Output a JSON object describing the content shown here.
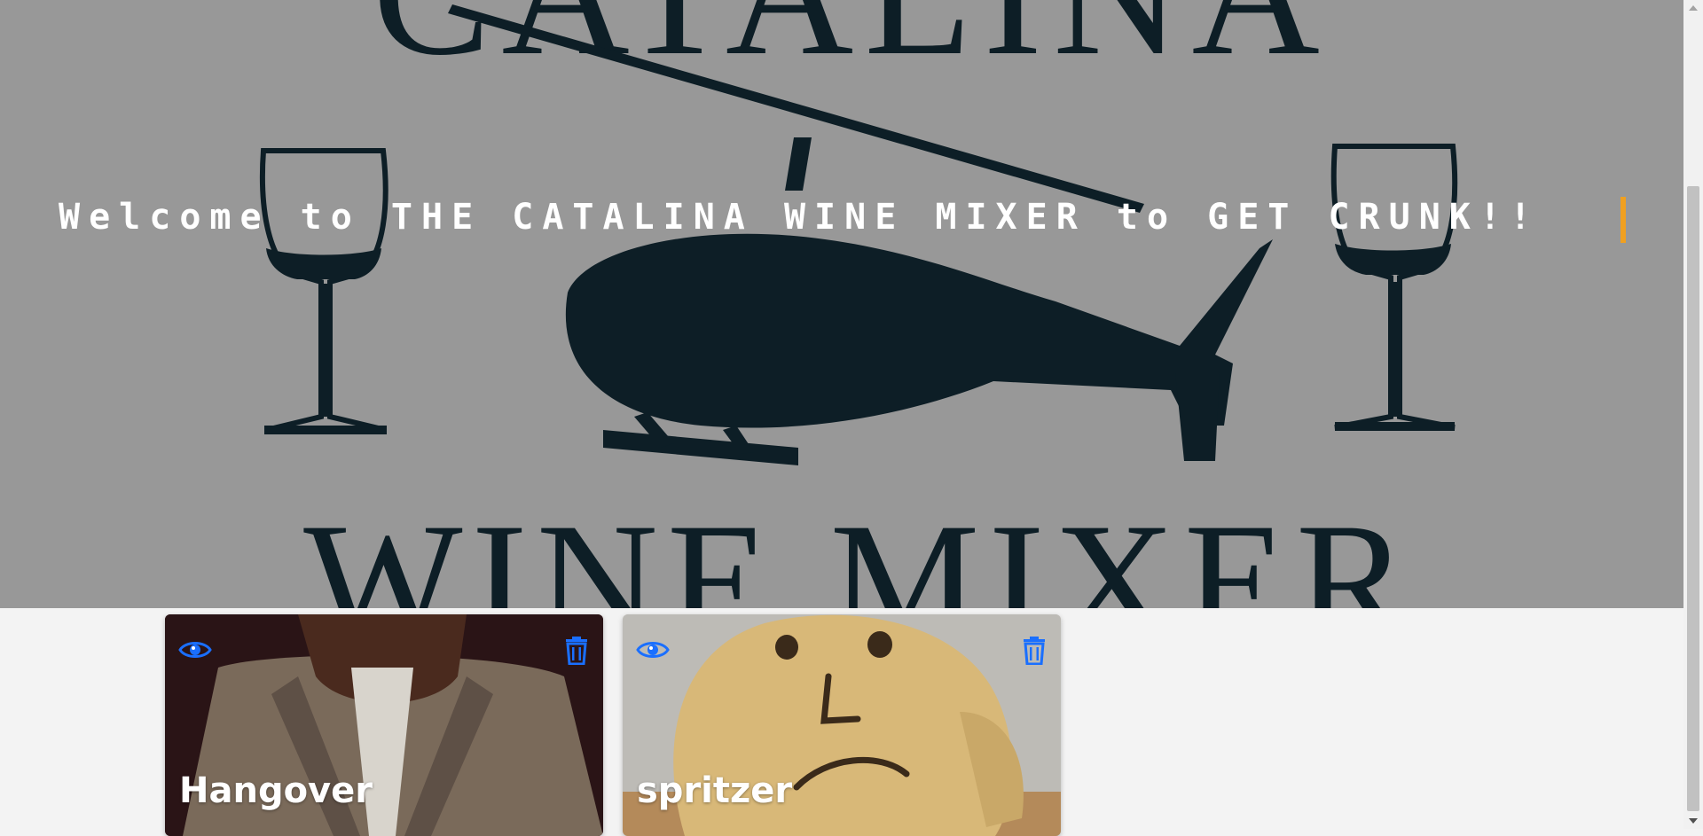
{
  "hero": {
    "welcome_text": "Welcome to THE CATALINA WINE MIXER to GET CRUNK!!",
    "logo_line1": "CATALINA",
    "logo_line2": "WINE MIXER",
    "accent_color": "#f0a020"
  },
  "cards": [
    {
      "title": "Hangover",
      "view_icon": "eye-icon",
      "delete_icon": "trash-icon"
    },
    {
      "title": "spritzer",
      "view_icon": "eye-icon",
      "delete_icon": "trash-icon"
    }
  ],
  "colors": {
    "icon_blue": "#1a6fff",
    "hero_overlay": "#989898",
    "page_background": "#f3f3f3"
  }
}
